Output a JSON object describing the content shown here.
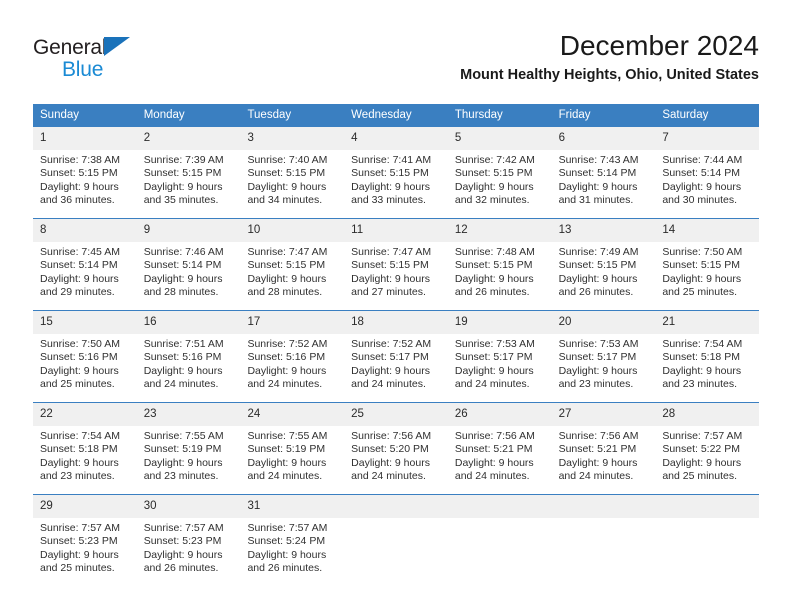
{
  "brand": {
    "name_part1": "General",
    "name_part2": "Blue",
    "flag_icon": "triangle-flag-icon"
  },
  "header": {
    "month_title": "December 2024",
    "location": "Mount Healthy Heights, Ohio, United States"
  },
  "colors": {
    "header_blue": "#3a7fc1",
    "brand_blue": "#1a8ad4",
    "flag_blue": "#1a72ba",
    "day_band_gray": "#f0f0f0",
    "text_dark": "#1a1a1a"
  },
  "weekdays": [
    "Sunday",
    "Monday",
    "Tuesday",
    "Wednesday",
    "Thursday",
    "Friday",
    "Saturday"
  ],
  "weeks": [
    [
      {
        "date": "1",
        "lines": [
          "Sunrise: 7:38 AM",
          "Sunset: 5:15 PM",
          "Daylight: 9 hours",
          "and 36 minutes."
        ]
      },
      {
        "date": "2",
        "lines": [
          "Sunrise: 7:39 AM",
          "Sunset: 5:15 PM",
          "Daylight: 9 hours",
          "and 35 minutes."
        ]
      },
      {
        "date": "3",
        "lines": [
          "Sunrise: 7:40 AM",
          "Sunset: 5:15 PM",
          "Daylight: 9 hours",
          "and 34 minutes."
        ]
      },
      {
        "date": "4",
        "lines": [
          "Sunrise: 7:41 AM",
          "Sunset: 5:15 PM",
          "Daylight: 9 hours",
          "and 33 minutes."
        ]
      },
      {
        "date": "5",
        "lines": [
          "Sunrise: 7:42 AM",
          "Sunset: 5:15 PM",
          "Daylight: 9 hours",
          "and 32 minutes."
        ]
      },
      {
        "date": "6",
        "lines": [
          "Sunrise: 7:43 AM",
          "Sunset: 5:14 PM",
          "Daylight: 9 hours",
          "and 31 minutes."
        ]
      },
      {
        "date": "7",
        "lines": [
          "Sunrise: 7:44 AM",
          "Sunset: 5:14 PM",
          "Daylight: 9 hours",
          "and 30 minutes."
        ]
      }
    ],
    [
      {
        "date": "8",
        "lines": [
          "Sunrise: 7:45 AM",
          "Sunset: 5:14 PM",
          "Daylight: 9 hours",
          "and 29 minutes."
        ]
      },
      {
        "date": "9",
        "lines": [
          "Sunrise: 7:46 AM",
          "Sunset: 5:14 PM",
          "Daylight: 9 hours",
          "and 28 minutes."
        ]
      },
      {
        "date": "10",
        "lines": [
          "Sunrise: 7:47 AM",
          "Sunset: 5:15 PM",
          "Daylight: 9 hours",
          "and 28 minutes."
        ]
      },
      {
        "date": "11",
        "lines": [
          "Sunrise: 7:47 AM",
          "Sunset: 5:15 PM",
          "Daylight: 9 hours",
          "and 27 minutes."
        ]
      },
      {
        "date": "12",
        "lines": [
          "Sunrise: 7:48 AM",
          "Sunset: 5:15 PM",
          "Daylight: 9 hours",
          "and 26 minutes."
        ]
      },
      {
        "date": "13",
        "lines": [
          "Sunrise: 7:49 AM",
          "Sunset: 5:15 PM",
          "Daylight: 9 hours",
          "and 26 minutes."
        ]
      },
      {
        "date": "14",
        "lines": [
          "Sunrise: 7:50 AM",
          "Sunset: 5:15 PM",
          "Daylight: 9 hours",
          "and 25 minutes."
        ]
      }
    ],
    [
      {
        "date": "15",
        "lines": [
          "Sunrise: 7:50 AM",
          "Sunset: 5:16 PM",
          "Daylight: 9 hours",
          "and 25 minutes."
        ]
      },
      {
        "date": "16",
        "lines": [
          "Sunrise: 7:51 AM",
          "Sunset: 5:16 PM",
          "Daylight: 9 hours",
          "and 24 minutes."
        ]
      },
      {
        "date": "17",
        "lines": [
          "Sunrise: 7:52 AM",
          "Sunset: 5:16 PM",
          "Daylight: 9 hours",
          "and 24 minutes."
        ]
      },
      {
        "date": "18",
        "lines": [
          "Sunrise: 7:52 AM",
          "Sunset: 5:17 PM",
          "Daylight: 9 hours",
          "and 24 minutes."
        ]
      },
      {
        "date": "19",
        "lines": [
          "Sunrise: 7:53 AM",
          "Sunset: 5:17 PM",
          "Daylight: 9 hours",
          "and 24 minutes."
        ]
      },
      {
        "date": "20",
        "lines": [
          "Sunrise: 7:53 AM",
          "Sunset: 5:17 PM",
          "Daylight: 9 hours",
          "and 23 minutes."
        ]
      },
      {
        "date": "21",
        "lines": [
          "Sunrise: 7:54 AM",
          "Sunset: 5:18 PM",
          "Daylight: 9 hours",
          "and 23 minutes."
        ]
      }
    ],
    [
      {
        "date": "22",
        "lines": [
          "Sunrise: 7:54 AM",
          "Sunset: 5:18 PM",
          "Daylight: 9 hours",
          "and 23 minutes."
        ]
      },
      {
        "date": "23",
        "lines": [
          "Sunrise: 7:55 AM",
          "Sunset: 5:19 PM",
          "Daylight: 9 hours",
          "and 23 minutes."
        ]
      },
      {
        "date": "24",
        "lines": [
          "Sunrise: 7:55 AM",
          "Sunset: 5:19 PM",
          "Daylight: 9 hours",
          "and 24 minutes."
        ]
      },
      {
        "date": "25",
        "lines": [
          "Sunrise: 7:56 AM",
          "Sunset: 5:20 PM",
          "Daylight: 9 hours",
          "and 24 minutes."
        ]
      },
      {
        "date": "26",
        "lines": [
          "Sunrise: 7:56 AM",
          "Sunset: 5:21 PM",
          "Daylight: 9 hours",
          "and 24 minutes."
        ]
      },
      {
        "date": "27",
        "lines": [
          "Sunrise: 7:56 AM",
          "Sunset: 5:21 PM",
          "Daylight: 9 hours",
          "and 24 minutes."
        ]
      },
      {
        "date": "28",
        "lines": [
          "Sunrise: 7:57 AM",
          "Sunset: 5:22 PM",
          "Daylight: 9 hours",
          "and 25 minutes."
        ]
      }
    ],
    [
      {
        "date": "29",
        "lines": [
          "Sunrise: 7:57 AM",
          "Sunset: 5:23 PM",
          "Daylight: 9 hours",
          "and 25 minutes."
        ]
      },
      {
        "date": "30",
        "lines": [
          "Sunrise: 7:57 AM",
          "Sunset: 5:23 PM",
          "Daylight: 9 hours",
          "and 26 minutes."
        ]
      },
      {
        "date": "31",
        "lines": [
          "Sunrise: 7:57 AM",
          "Sunset: 5:24 PM",
          "Daylight: 9 hours",
          "and 26 minutes."
        ]
      },
      {
        "date": "",
        "lines": []
      },
      {
        "date": "",
        "lines": []
      },
      {
        "date": "",
        "lines": []
      },
      {
        "date": "",
        "lines": []
      }
    ]
  ]
}
